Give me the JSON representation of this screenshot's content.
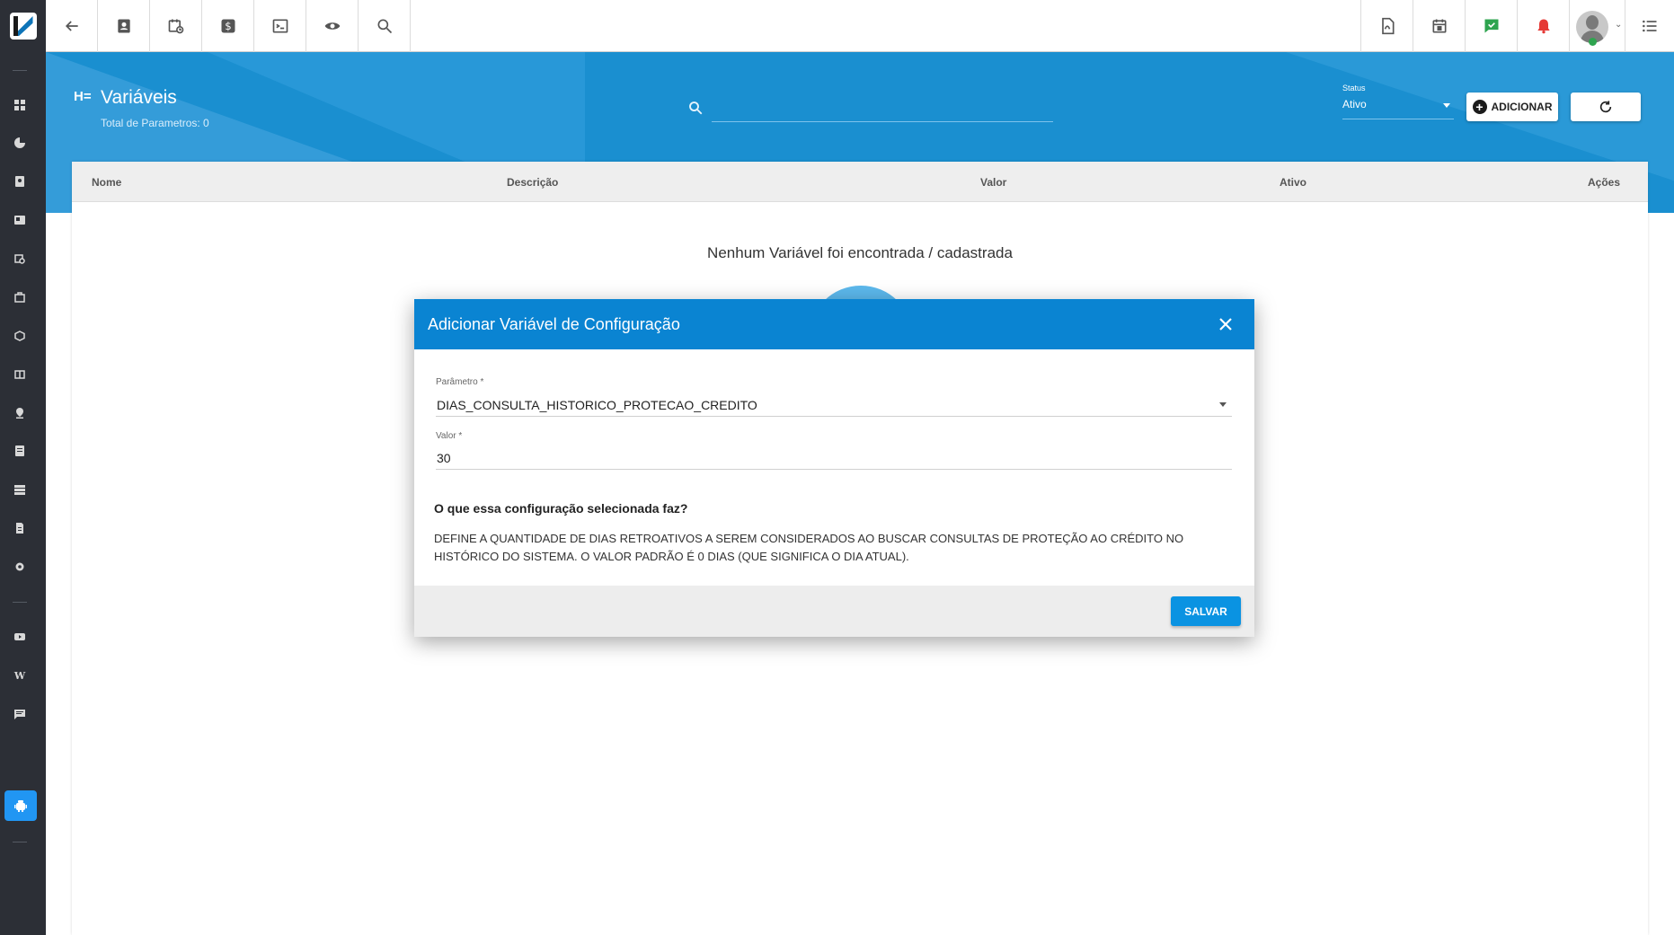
{
  "toolbar": {
    "left_icons": [
      "back-arrow-icon",
      "contact-card-icon",
      "calendar-clock-icon",
      "dollar-icon",
      "terminal-icon",
      "eye-icon",
      "search-icon"
    ],
    "right_icons": [
      "pdf-file-icon",
      "calendar-icon",
      "chat-check-icon",
      "alarm-bell-icon",
      "menu-list-icon"
    ],
    "accent_colors": {
      "chat": "#2ea44f",
      "alarm": "#e53935"
    }
  },
  "sidebar": {
    "items": [
      "grid-icon",
      "chart-icon",
      "contact-icon",
      "card-icon",
      "calendar-clock-icon",
      "briefcase-icon",
      "box-icon",
      "id-card-icon",
      "location-icon",
      "list-icon",
      "server-icon",
      "document-icon",
      "gear-icon",
      "video-icon",
      "wiki-icon",
      "chat-icon",
      "robot-icon"
    ],
    "wiki_letter": "W",
    "active_item": "robot-icon"
  },
  "header": {
    "title": "Variáveis",
    "subtitle": "Total de Parametros: 0",
    "search_placeholder": "",
    "status_label": "Status",
    "status_value": "Ativo",
    "add_button": "ADICIONAR"
  },
  "table": {
    "columns": [
      "Nome",
      "Descrição",
      "Valor",
      "Ativo",
      "Ações"
    ],
    "empty_message": "Nenhum Variável foi encontrada / cadastrada"
  },
  "modal": {
    "title": "Adicionar Variável de Configuração",
    "param_label": "Parâmetro *",
    "param_value": "DIAS_CONSULTA_HISTORICO_PROTECAO_CREDITO",
    "value_label": "Valor *",
    "value_value": "30",
    "question": "O que essa configuração selecionada faz?",
    "description": "DEFINE A QUANTIDADE DE DIAS RETROATIVOS A SEREM CONSIDERADOS AO BUSCAR CONSULTAS DE PROTEÇÃO AO CRÉDITO NO HISTÓRICO DO SISTEMA. O VALOR PADRÃO É 0 DIAS (QUE SIGNIFICA O DIA ATUAL).",
    "save_button": "SALVAR"
  },
  "colors": {
    "header_blue": "#1a8fd0",
    "modal_header": "#0a84d2",
    "save_button": "#0a93e2",
    "sidebar": "#2c2f36",
    "sidebar_active": "#2196f3"
  }
}
